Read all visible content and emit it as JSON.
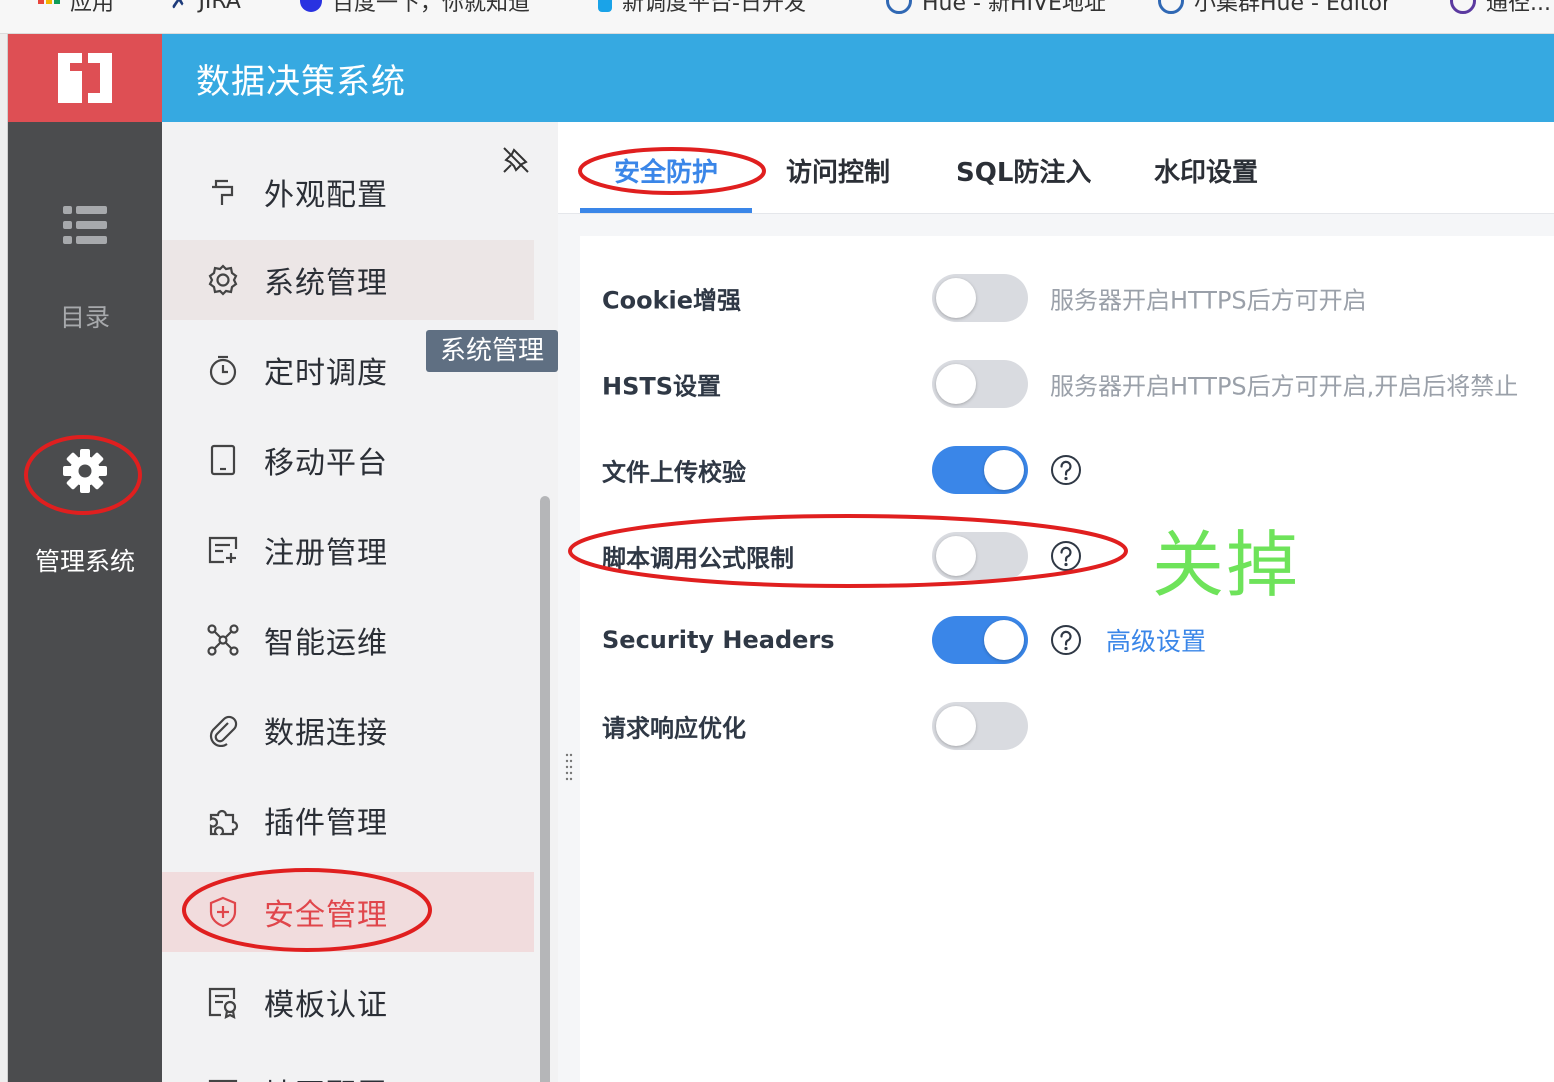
{
  "bookmarks": [
    {
      "label": "应用",
      "color": "#e8453c"
    },
    {
      "label": "JIRA",
      "color": "#1d3b7a"
    },
    {
      "label": "百度一下，你就知道",
      "color": "#2932e1"
    },
    {
      "label": "新调度平台-日开发",
      "color": "#1aa3e8"
    },
    {
      "label": "Hue - 新HIVE地址",
      "color": "#3068b4"
    },
    {
      "label": "小集群Hue - Editor",
      "color": "#3068b4"
    },
    {
      "label": "通径...",
      "color": "#5b3aa0"
    }
  ],
  "header": {
    "title": "数据决策系统",
    "logo_color": "#de4f54",
    "bg_color": "#36a9e1"
  },
  "dark_nav": {
    "items": [
      {
        "label": "目录",
        "icon": "list-icon",
        "active": false
      },
      {
        "label": "管理系统",
        "icon": "gear-icon",
        "active": true
      }
    ]
  },
  "sub_menu": {
    "items": [
      {
        "label": "外观配置",
        "icon": "brush-icon"
      },
      {
        "label": "系统管理",
        "icon": "settings-icon",
        "state": "hover"
      },
      {
        "label": "定时调度",
        "icon": "timer-icon"
      },
      {
        "label": "移动平台",
        "icon": "tablet-icon"
      },
      {
        "label": "注册管理",
        "icon": "register-icon"
      },
      {
        "label": "智能运维",
        "icon": "network-icon"
      },
      {
        "label": "数据连接",
        "icon": "paperclip-icon"
      },
      {
        "label": "插件管理",
        "icon": "puzzle-icon"
      },
      {
        "label": "安全管理",
        "icon": "shield-icon",
        "state": "selected"
      },
      {
        "label": "模板认证",
        "icon": "certificate-icon"
      },
      {
        "label": "地图配置",
        "icon": "map-icon"
      }
    ],
    "tooltip": "系统管理"
  },
  "tabs": [
    {
      "label": "安全防护",
      "active": true
    },
    {
      "label": "访问控制",
      "active": false
    },
    {
      "label": "SQL防注入",
      "active": false
    },
    {
      "label": "水印设置",
      "active": false
    }
  ],
  "settings": [
    {
      "label": "Cookie增强",
      "enabled": false,
      "hint": "服务器开启HTTPS后方可开启"
    },
    {
      "label": "HSTS设置",
      "enabled": false,
      "hint": "服务器开启HTTPS后方可开启,开启后将禁止"
    },
    {
      "label": "文件上传校验",
      "enabled": true,
      "help": true
    },
    {
      "label": "脚本调用公式限制",
      "enabled": false,
      "help": true
    },
    {
      "label": "Security Headers",
      "enabled": true,
      "help": true,
      "link": "高级设置"
    },
    {
      "label": "请求响应优化",
      "enabled": false
    }
  ],
  "annotation": {
    "note": "关掉",
    "note_color": "#6ee35a",
    "circle_color": "#e01f1f"
  },
  "colors": {
    "accent": "#3a86e8",
    "danger": "#e0464b",
    "nav_dark": "#4b4c4e"
  }
}
